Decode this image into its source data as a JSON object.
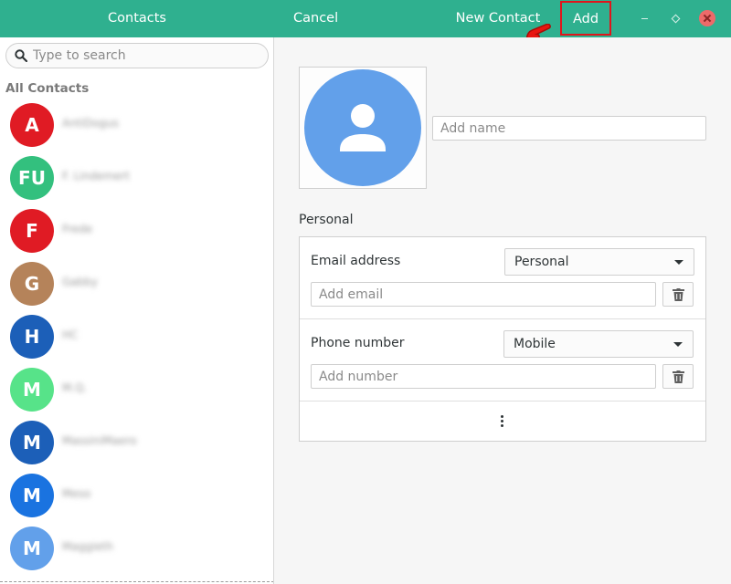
{
  "header": {
    "left_title": "Contacts",
    "cancel_label": "Cancel",
    "right_title": "New Contact",
    "add_label": "Add",
    "window_controls": [
      "minimize-icon",
      "maximize-icon",
      "close-icon"
    ]
  },
  "sidebar": {
    "search_placeholder": "Type to search",
    "section_title": "All Contacts",
    "contacts": [
      {
        "initials": "A",
        "color": "#e01b24",
        "name": "AntiDogus"
      },
      {
        "initials": "FU",
        "color": "#33c07e",
        "name": "F. Lindemert"
      },
      {
        "initials": "F",
        "color": "#e01b24",
        "name": "Frede"
      },
      {
        "initials": "G",
        "color": "#b5835a",
        "name": "Gabby"
      },
      {
        "initials": "H",
        "color": "#1c5fb8",
        "name": "HC"
      },
      {
        "initials": "M",
        "color": "#57e389",
        "name": "M.Q."
      },
      {
        "initials": "M",
        "color": "#1c5fb8",
        "name": "MassiniMaero"
      },
      {
        "initials": "M",
        "color": "#1a73e0",
        "name": "Meso"
      },
      {
        "initials": "M",
        "color": "#62a0ea",
        "name": "Maggieth"
      }
    ]
  },
  "editor": {
    "name_placeholder": "Add name",
    "group_label": "Personal",
    "email_label": "Email address",
    "email_type": "Personal",
    "email_placeholder": "Add email",
    "phone_label": "Phone number",
    "phone_type": "Mobile",
    "phone_placeholder": "Add number"
  },
  "colors": {
    "headerbar": "#2fb08f",
    "avatar_placeholder": "#62a0ea",
    "highlight": "#e0151b"
  }
}
